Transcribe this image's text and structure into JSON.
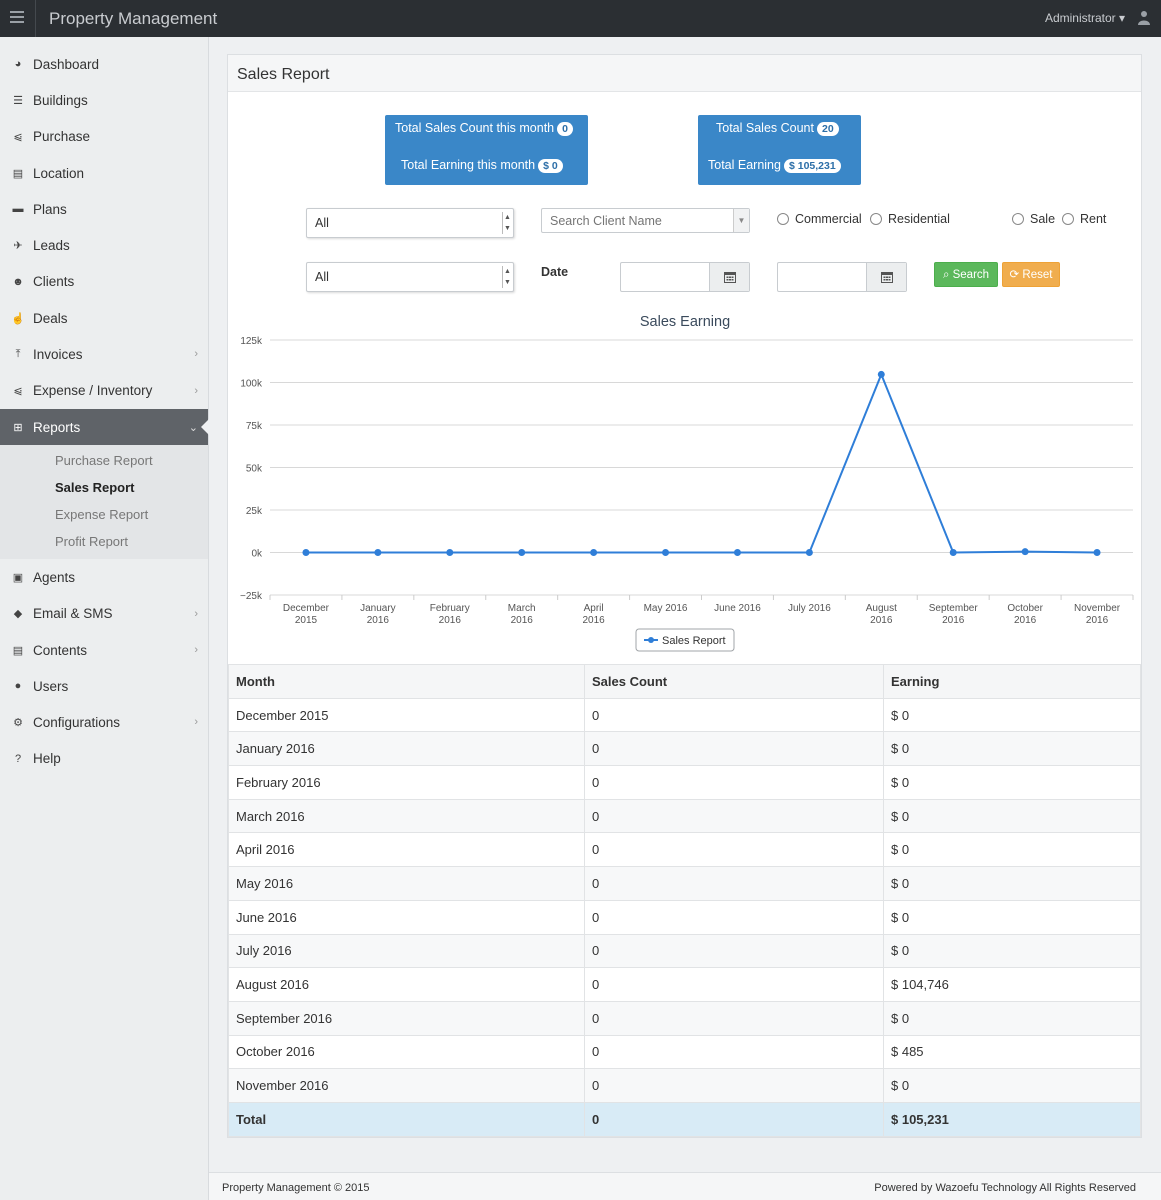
{
  "app": {
    "brand": "Property Management",
    "user_menu": "Administrator ▾"
  },
  "sidebar": {
    "items": [
      {
        "label": "Dashboard",
        "icon": "dashboard-icon",
        "glyph": "◕"
      },
      {
        "label": "Buildings",
        "icon": "list-icon",
        "glyph": "☰"
      },
      {
        "label": "Purchase",
        "icon": "cart-icon",
        "glyph": "⩿"
      },
      {
        "label": "Location",
        "icon": "document-icon",
        "glyph": "▤"
      },
      {
        "label": "Plans",
        "icon": "briefcase-icon",
        "glyph": "▬"
      },
      {
        "label": "Leads",
        "icon": "rocket-icon",
        "glyph": "✈"
      },
      {
        "label": "Clients",
        "icon": "users-icon",
        "glyph": "☻"
      },
      {
        "label": "Deals",
        "icon": "thumbs-up-icon",
        "glyph": "☝"
      },
      {
        "label": "Invoices",
        "icon": "pin-icon",
        "glyph": "⤒"
      },
      {
        "label": "Expense / Inventory",
        "icon": "cart-icon",
        "glyph": "⩿"
      },
      {
        "label": "Reports",
        "icon": "table-icon",
        "glyph": "⊞"
      },
      {
        "label": "Agents",
        "icon": "lock-icon",
        "glyph": "▣"
      },
      {
        "label": "Email & SMS",
        "icon": "shield-icon",
        "glyph": "◆"
      },
      {
        "label": "Contents",
        "icon": "newspaper-icon",
        "glyph": "▤"
      },
      {
        "label": "Users",
        "icon": "user-icon",
        "glyph": "●"
      },
      {
        "label": "Configurations",
        "icon": "gears-icon",
        "glyph": "⚙"
      },
      {
        "label": "Help",
        "icon": "question-circle-icon",
        "glyph": "?"
      }
    ],
    "reports_sub": [
      "Purchase Report",
      "Sales Report",
      "Expense Report",
      "Profit Report"
    ]
  },
  "page": {
    "title": "Sales Report"
  },
  "stats": {
    "month_count_label": "Total Sales Count this month",
    "month_count": "0",
    "month_earning_label": "Total Earning this month",
    "month_earning": "$ 0",
    "total_count_label": "Total Sales Count",
    "total_count": "20",
    "total_earning_label": "Total Earning",
    "total_earning": "$ 105,231"
  },
  "filters": {
    "select1": "All",
    "select2": "All",
    "client_placeholder": "Search Client Name",
    "radio_commercial": "Commercial",
    "radio_residential": "Residential",
    "radio_sale": "Sale",
    "radio_rent": "Rent",
    "date_label": "Date",
    "search_button": "Search",
    "reset_button": "Reset"
  },
  "colors": {
    "series": "#2f7ed8",
    "box": "#3a87c8",
    "search": "#5cb85c",
    "reset": "#f0ad4e"
  },
  "chart_data": {
    "type": "line",
    "title": "Sales Earning",
    "categories": [
      "December 2015",
      "January 2016",
      "February 2016",
      "March 2016",
      "April 2016",
      "May 2016",
      "June 2016",
      "July 2016",
      "August 2016",
      "September 2016",
      "October 2016",
      "November 2016"
    ],
    "series": [
      {
        "name": "Sales Report",
        "values": [
          0,
          0,
          0,
          0,
          0,
          0,
          0,
          0,
          104746,
          0,
          485,
          0
        ]
      }
    ],
    "ylim": [
      -25000,
      125000
    ],
    "yticks": [
      125000,
      100000,
      75000,
      50000,
      25000,
      0,
      -25000
    ],
    "ytick_labels": [
      "125k",
      "100k",
      "75k",
      "50k",
      "25k",
      "0k",
      "−25k"
    ],
    "grid": true,
    "legend": "bottom-center"
  },
  "table": {
    "headers": [
      "Month",
      "Sales Count",
      "Earning"
    ],
    "rows": [
      [
        "December 2015",
        "0",
        "$ 0"
      ],
      [
        "January 2016",
        "0",
        "$ 0"
      ],
      [
        "February 2016",
        "0",
        "$ 0"
      ],
      [
        "March 2016",
        "0",
        "$ 0"
      ],
      [
        "April 2016",
        "0",
        "$ 0"
      ],
      [
        "May 2016",
        "0",
        "$ 0"
      ],
      [
        "June 2016",
        "0",
        "$ 0"
      ],
      [
        "July 2016",
        "0",
        "$ 0"
      ],
      [
        "August 2016",
        "0",
        "$ 104,746"
      ],
      [
        "September 2016",
        "0",
        "$ 0"
      ],
      [
        "October 2016",
        "0",
        "$ 485"
      ],
      [
        "November 2016",
        "0",
        "$ 0"
      ]
    ],
    "total": [
      "Total",
      "0",
      "$ 105,231"
    ]
  },
  "footer": {
    "left": "Property Management © 2015",
    "right": "Powered by Wazoefu Technology All Rights Reserved"
  }
}
